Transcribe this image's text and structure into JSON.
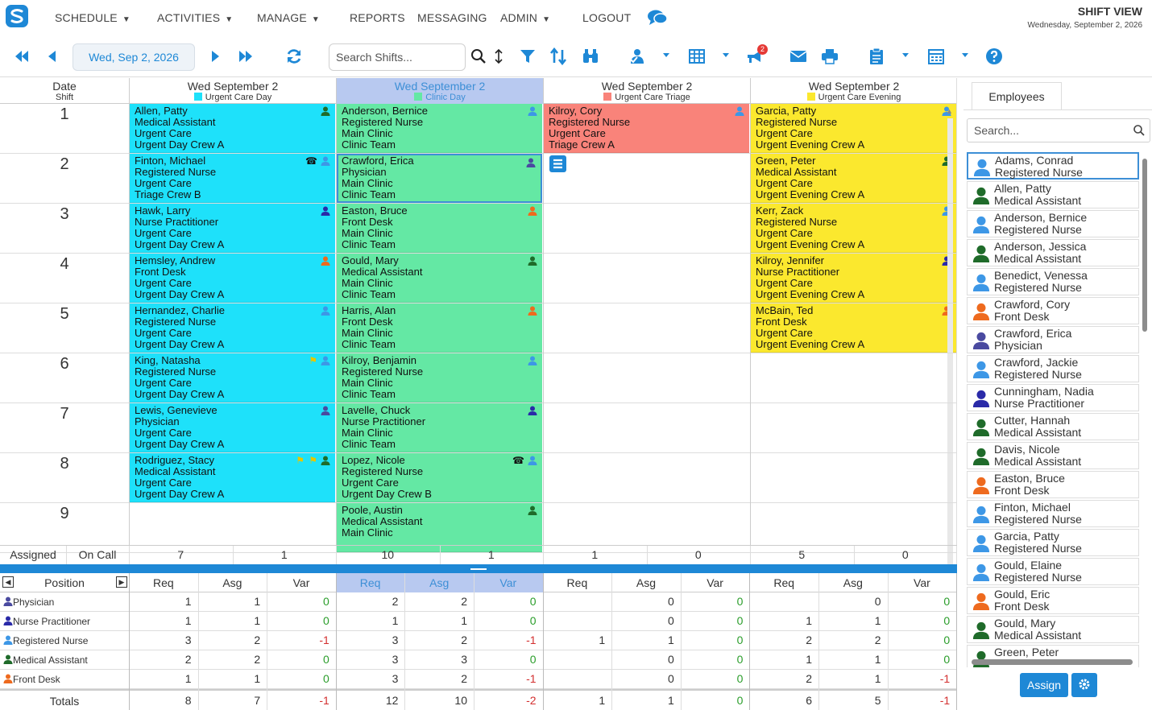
{
  "nav": {
    "items": [
      "SCHEDULE",
      "ACTIVITIES",
      "MANAGE",
      "REPORTS",
      "MESSAGING",
      "ADMIN",
      "LOGOUT"
    ],
    "view_title": "SHIFT VIEW",
    "view_date": "Wednesday, September 2, 2026"
  },
  "toolbar": {
    "date": "Wed, Sep 2, 2026",
    "search_placeholder": "Search Shifts...",
    "badge": "2"
  },
  "grid": {
    "date_header": "Date",
    "shift_header": "Shift",
    "columns": [
      {
        "title": "Wed September 2",
        "shift": "Urgent Care Day",
        "color": "#1ee1fa",
        "selected": false
      },
      {
        "title": "Wed September 2",
        "shift": "Clinic Day",
        "color": "#64e8a4",
        "selected": true
      },
      {
        "title": "Wed September 2",
        "shift": "Urgent Care Triage",
        "color": "#f9837a",
        "selected": false
      },
      {
        "title": "Wed September 2",
        "shift": "Urgent Care Evening",
        "color": "#fbe82e",
        "selected": false
      }
    ],
    "rows": [
      "1",
      "2",
      "3",
      "4",
      "5",
      "6",
      "7",
      "8",
      "9"
    ],
    "cards": [
      [
        {
          "name": "Allen, Patty",
          "role": "Medical Assistant",
          "loc": "Urgent Care",
          "team": "Urgent Day Crew A",
          "icon": "green"
        },
        {
          "name": "Finton, Michael",
          "role": "Registered Nurse",
          "loc": "Urgent Care",
          "team": "Triage Crew B",
          "icon": "blue",
          "phone": true
        },
        {
          "name": "Hawk, Larry",
          "role": "Nurse Practitioner",
          "loc": "Urgent Care",
          "team": "Urgent Day Crew A",
          "icon": "navy"
        },
        {
          "name": "Hemsley, Andrew",
          "role": "Front Desk",
          "loc": "Urgent Care",
          "team": "Urgent Day Crew A",
          "icon": "orange"
        },
        {
          "name": "Hernandez, Charlie",
          "role": "Registered Nurse",
          "loc": "Urgent Care",
          "team": "Urgent Day Crew A",
          "icon": "blue"
        },
        {
          "name": "King, Natasha",
          "role": "Registered Nurse",
          "loc": "Urgent Care",
          "team": "Urgent Day Crew A",
          "icon": "blue",
          "flags": 1
        },
        {
          "name": "Lewis, Genevieve",
          "role": "Physician",
          "loc": "Urgent Care",
          "team": "Urgent Day Crew A",
          "icon": "indigo"
        },
        {
          "name": "Rodriguez, Stacy",
          "role": "Medical Assistant",
          "loc": "Urgent Care",
          "team": "Urgent Day Crew A",
          "icon": "green",
          "flags": 2
        }
      ],
      [
        {
          "name": "Anderson, Bernice",
          "role": "Registered Nurse",
          "loc": "Main Clinic",
          "team": "Clinic Team",
          "icon": "blue"
        },
        {
          "name": "Crawford, Erica",
          "role": "Physician",
          "loc": "Main Clinic",
          "team": "Clinic Team",
          "icon": "indigo"
        },
        {
          "name": "Easton, Bruce",
          "role": "Front Desk",
          "loc": "Main Clinic",
          "team": "Clinic Team",
          "icon": "orange"
        },
        {
          "name": "Gould, Mary",
          "role": "Medical Assistant",
          "loc": "Main Clinic",
          "team": "Clinic Team",
          "icon": "green"
        },
        {
          "name": "Harris, Alan",
          "role": "Front Desk",
          "loc": "Main Clinic",
          "team": "Clinic Team",
          "icon": "orange"
        },
        {
          "name": "Kilroy, Benjamin",
          "role": "Registered Nurse",
          "loc": "Main Clinic",
          "team": "Clinic Team",
          "icon": "blue"
        },
        {
          "name": "Lavelle, Chuck",
          "role": "Nurse Practitioner",
          "loc": "Main Clinic",
          "team": "Clinic Team",
          "icon": "navy"
        },
        {
          "name": "Lopez, Nicole",
          "role": "Registered Nurse",
          "loc": "Urgent Care",
          "team": "Urgent Day Crew B",
          "icon": "blue",
          "phone": true
        },
        {
          "name": "Poole, Austin",
          "role": "Medical Assistant",
          "loc": "Main Clinic",
          "team": "",
          "icon": "green"
        }
      ],
      [
        {
          "name": "Kilroy, Cory",
          "role": "Registered Nurse",
          "loc": "Urgent Care",
          "team": "Triage Crew A",
          "icon": "blue"
        }
      ],
      [
        {
          "name": "Garcia, Patty",
          "role": "Registered Nurse",
          "loc": "Urgent Care",
          "team": "Urgent Evening Crew A",
          "icon": "blue"
        },
        {
          "name": "Green, Peter",
          "role": "Medical Assistant",
          "loc": "Urgent Care",
          "team": "Urgent Evening Crew A",
          "icon": "green"
        },
        {
          "name": "Kerr, Zack",
          "role": "Registered Nurse",
          "loc": "Urgent Care",
          "team": "Urgent Evening Crew A",
          "icon": "blue"
        },
        {
          "name": "Kilroy, Jennifer",
          "role": "Nurse Practitioner",
          "loc": "Urgent Care",
          "team": "Urgent Evening Crew A",
          "icon": "navy"
        },
        {
          "name": "McBain, Ted",
          "role": "Front Desk",
          "loc": "Urgent Care",
          "team": "Urgent Evening Crew A",
          "icon": "orange"
        }
      ]
    ],
    "assigned_label": "Assigned",
    "oncall_label": "On Call",
    "counts": [
      "7",
      "1",
      "10",
      "1",
      "1",
      "0",
      "5",
      "0"
    ]
  },
  "summary": {
    "position_header": "Position",
    "sub_headers": [
      "Req",
      "Asg",
      "Var"
    ],
    "positions": [
      {
        "name": "Physician",
        "icon": "indigo",
        "vals": [
          "1",
          "1",
          "0",
          "2",
          "2",
          "0",
          "",
          "0",
          "0",
          "",
          "0",
          "0"
        ]
      },
      {
        "name": "Nurse Practitioner",
        "icon": "navy",
        "vals": [
          "1",
          "1",
          "0",
          "1",
          "1",
          "0",
          "",
          "0",
          "0",
          "1",
          "1",
          "0"
        ]
      },
      {
        "name": "Registered Nurse",
        "icon": "blue",
        "vals": [
          "3",
          "2",
          "-1",
          "3",
          "2",
          "-1",
          "1",
          "1",
          "0",
          "2",
          "2",
          "0"
        ]
      },
      {
        "name": "Medical Assistant",
        "icon": "green",
        "vals": [
          "2",
          "2",
          "0",
          "3",
          "3",
          "0",
          "",
          "0",
          "0",
          "1",
          "1",
          "0"
        ]
      },
      {
        "name": "Front Desk",
        "icon": "orange",
        "vals": [
          "1",
          "1",
          "0",
          "3",
          "2",
          "-1",
          "",
          "0",
          "0",
          "2",
          "1",
          "-1"
        ]
      }
    ],
    "totals_label": "Totals",
    "totals": [
      "8",
      "7",
      "-1",
      "12",
      "10",
      "-2",
      "1",
      "1",
      "0",
      "6",
      "5",
      "-1"
    ]
  },
  "employees": {
    "tab": "Employees",
    "search_placeholder": "Search...",
    "list": [
      {
        "name": "Adams, Conrad",
        "role": "Registered Nurse",
        "icon": "blue"
      },
      {
        "name": "Allen, Patty",
        "role": "Medical Assistant",
        "icon": "green"
      },
      {
        "name": "Anderson, Bernice",
        "role": "Registered Nurse",
        "icon": "blue"
      },
      {
        "name": "Anderson, Jessica",
        "role": "Medical Assistant",
        "icon": "green"
      },
      {
        "name": "Benedict, Venessa",
        "role": "Registered Nurse",
        "icon": "blue"
      },
      {
        "name": "Crawford, Cory",
        "role": "Front Desk",
        "icon": "orange"
      },
      {
        "name": "Crawford, Erica",
        "role": "Physician",
        "icon": "indigo"
      },
      {
        "name": "Crawford, Jackie",
        "role": "Registered Nurse",
        "icon": "blue"
      },
      {
        "name": "Cunningham, Nadia",
        "role": "Nurse Practitioner",
        "icon": "navy"
      },
      {
        "name": "Cutter, Hannah",
        "role": "Medical Assistant",
        "icon": "green"
      },
      {
        "name": "Davis, Nicole",
        "role": "Medical Assistant",
        "icon": "green"
      },
      {
        "name": "Easton, Bruce",
        "role": "Front Desk",
        "icon": "orange"
      },
      {
        "name": "Finton, Michael",
        "role": "Registered Nurse",
        "icon": "blue"
      },
      {
        "name": "Garcia, Patty",
        "role": "Registered Nurse",
        "icon": "blue"
      },
      {
        "name": "Gould, Elaine",
        "role": "Registered Nurse",
        "icon": "blue"
      },
      {
        "name": "Gould, Eric",
        "role": "Front Desk",
        "icon": "orange"
      },
      {
        "name": "Gould, Mary",
        "role": "Medical Assistant",
        "icon": "green"
      },
      {
        "name": "Green, Peter",
        "role": "",
        "icon": "green"
      }
    ],
    "assign_label": "Assign"
  },
  "icon_colors": {
    "blue": "#3d97e6",
    "green": "#1f6b2a",
    "navy": "#2a2aa8",
    "indigo": "#4a4aa0",
    "orange": "#ee6a1e"
  }
}
